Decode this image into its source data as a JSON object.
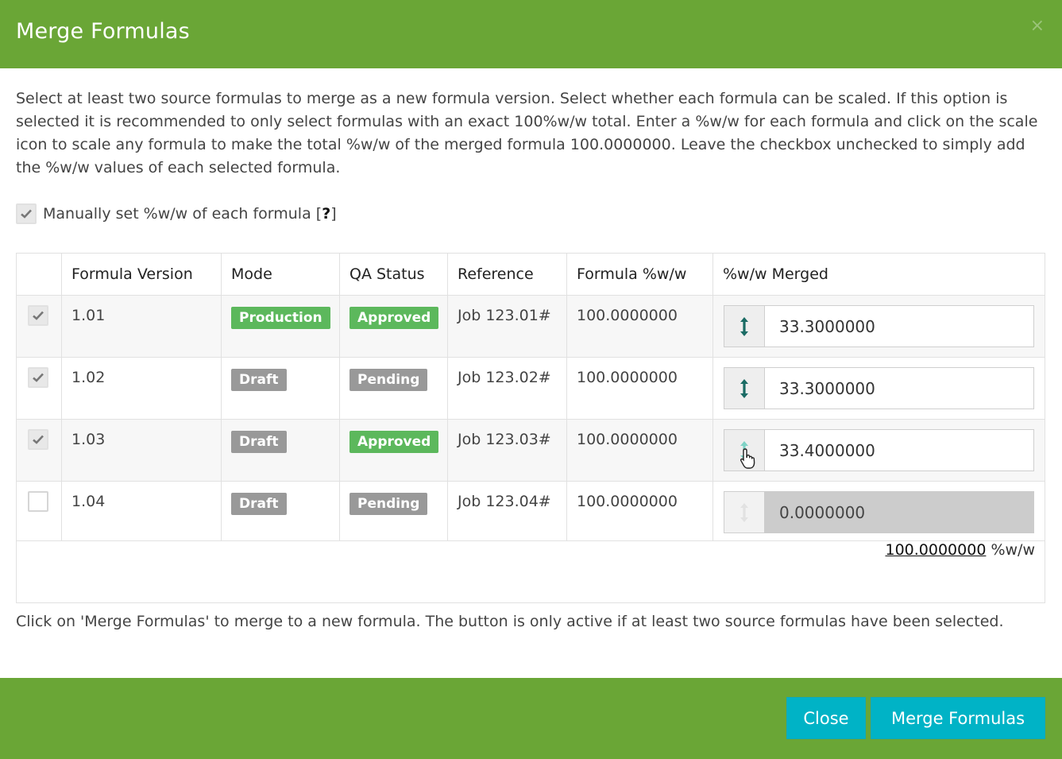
{
  "header": {
    "title": "Merge Formulas",
    "close_glyph": "×"
  },
  "intro_text": "Select at least two source formulas to merge as a new formula version. Select whether each formula can be scaled. If this option is selected it is recommended to only select formulas with an exact 100%w/w total. Enter a %w/w for each formula and click on the scale icon to scale any formula to make the total %w/w of the merged formula 100.0000000. Leave the checkbox unchecked to simply add the %w/w values of each selected formula.",
  "manual_option": {
    "label": "Manually set %w/w of each formula [",
    "help": "?",
    "label_end": "]",
    "checked": true
  },
  "table": {
    "columns": [
      "",
      "Formula Version",
      "Mode",
      "QA Status",
      "Reference",
      "Formula %w/w",
      "%w/w Merged"
    ],
    "rows": [
      {
        "checked": true,
        "version": "1.01",
        "mode": "Production",
        "mode_color": "#5cb85c",
        "qa": "Approved",
        "qa_color": "#5cb85c",
        "reference": "Job 123.01#",
        "formula_ww": "100.0000000",
        "merged": "33.3000000",
        "enabled": true
      },
      {
        "checked": true,
        "version": "1.02",
        "mode": "Draft",
        "mode_color": "#999999",
        "qa": "Pending",
        "qa_color": "#999999",
        "reference": "Job 123.02#",
        "formula_ww": "100.0000000",
        "merged": "33.3000000",
        "enabled": true
      },
      {
        "checked": true,
        "version": "1.03",
        "mode": "Draft",
        "mode_color": "#999999",
        "qa": "Approved",
        "qa_color": "#5cb85c",
        "reference": "Job 123.03#",
        "formula_ww": "100.0000000",
        "merged": "33.4000000",
        "enabled": true
      },
      {
        "checked": false,
        "version": "1.04",
        "mode": "Draft",
        "mode_color": "#999999",
        "qa": "Pending",
        "qa_color": "#999999",
        "reference": "Job 123.04#",
        "formula_ww": "100.0000000",
        "merged": "0.0000000",
        "enabled": false
      }
    ],
    "total": {
      "value": "100.0000000",
      "unit": " %w/w"
    }
  },
  "outro_text": "Click on 'Merge Formulas' to merge to a new formula. The button is only active if at least two source formulas have been selected.",
  "footer": {
    "close_label": "Close",
    "merge_label": "Merge Formulas"
  },
  "icons": {
    "check": "check-icon",
    "scale": "vertical-arrows-icon",
    "cursor": "hand-pointer-icon",
    "close": "close-icon"
  },
  "colors": {
    "brand_green": "#6aa636",
    "button_teal": "#00b3c6",
    "badge_green": "#5cb85c",
    "badge_grey": "#999999",
    "icon_teal": "#1a6b64"
  }
}
